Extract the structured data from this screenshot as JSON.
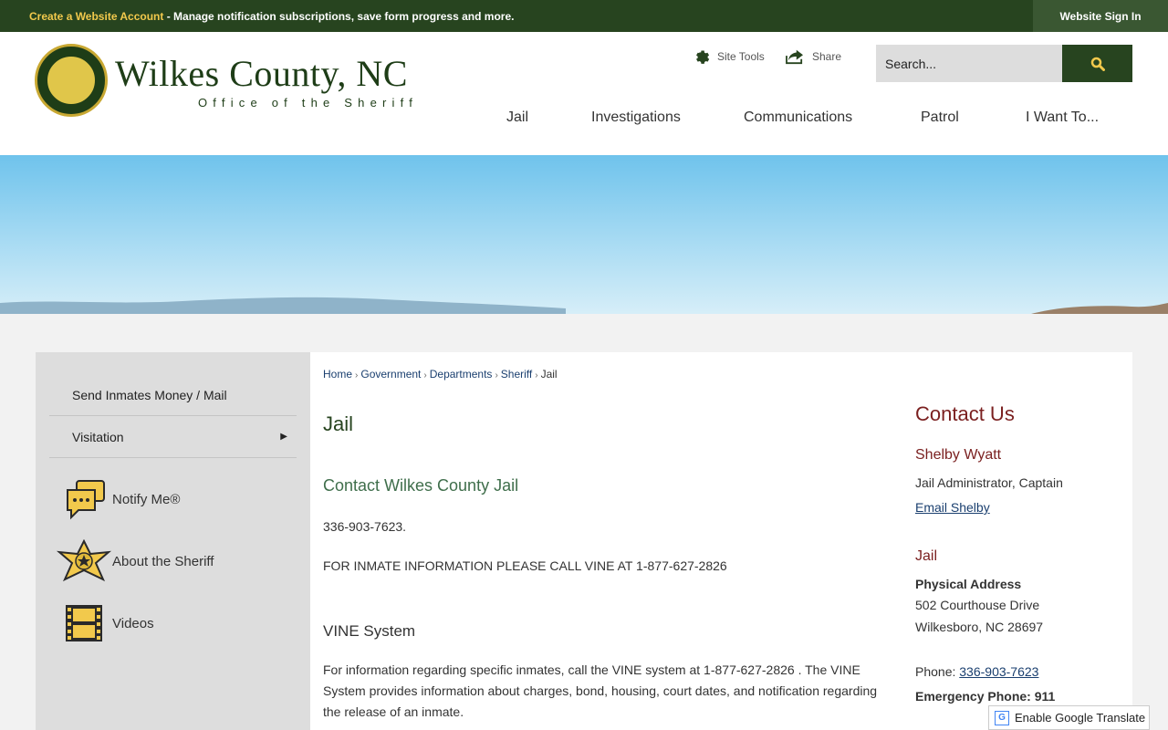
{
  "topbar": {
    "account_link": "Create a Website Account",
    "message": " - Manage notification subscriptions, save form progress and more.",
    "signin": "Website Sign In"
  },
  "brand": {
    "title": "Wilkes County, NC",
    "subtitle": "Office of the Sheriff"
  },
  "tools": {
    "site_tools": "Site Tools",
    "share": "Share"
  },
  "search": {
    "placeholder": "Search..."
  },
  "nav": {
    "items": [
      "Jail",
      "Investigations",
      "Communications",
      "Patrol",
      "I Want To..."
    ]
  },
  "sidebar": {
    "links": [
      {
        "label": "Send Inmates Money / Mail"
      },
      {
        "label": "Visitation",
        "arrow": "▶"
      }
    ],
    "quick_links": [
      "Notify Me®",
      "About the Sheriff",
      "Videos"
    ]
  },
  "breadcrumb": [
    "Home",
    "Government",
    "Departments",
    "Sheriff",
    "Jail"
  ],
  "main": {
    "title": "Jail",
    "section1_title": "Contact Wilkes County Jail",
    "phone_line": " 336-903-7623.",
    "inmate_info": "FOR INMATE INFORMATION PLEASE CALL VINE AT 1-877-627-2826",
    "section2_title": "VINE System",
    "vine_text": "For information regarding specific inmates, call the VINE system at 1-877-627-2826 . The VINE System provides information about charges, bond, housing, court dates, and notification regarding the release of an inmate."
  },
  "contact": {
    "title": "Contact Us",
    "name": "Shelby Wyatt",
    "role": "Jail Administrator, Captain",
    "email_link": "Email Shelby",
    "location_name": "Jail",
    "address_label": "Physical Address",
    "address1": "502 Courthouse Drive",
    "address2": "Wilkesboro, NC 28697",
    "phone_label": "Phone: ",
    "phone": "336-903-7623",
    "emergency_label": "Emergency Phone: ",
    "emergency": "911"
  },
  "translate": {
    "label": "Enable Google Translate",
    "icon_letter": "G"
  },
  "colors": {
    "brand_green": "#27441f",
    "accent_gold": "#f2c94c",
    "contact_red": "#7a1f1f",
    "link_blue": "#1a3f6f"
  }
}
